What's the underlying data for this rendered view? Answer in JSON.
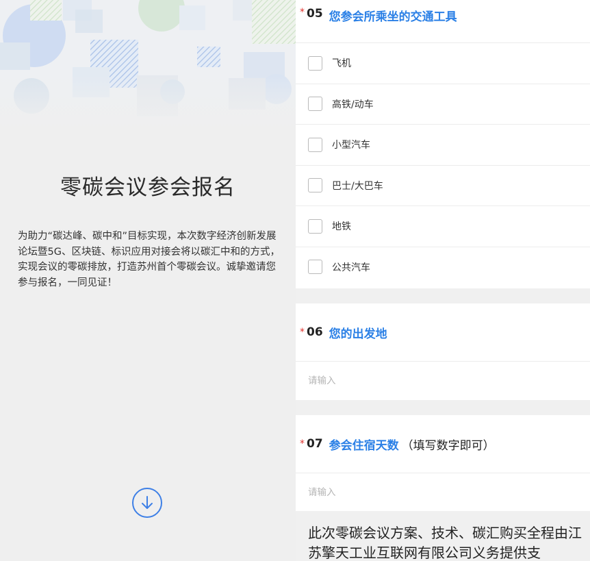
{
  "intro": {
    "title": "零碳会议参会报名",
    "description": "为助力“碳达峰、碳中和”目标实现，本次数字经济创新发展论坛暨5G、区块链、标识应用对接会将以碳汇中和的方式，实现会议的零碳排放，打造苏州首个零碳会议。诚挚邀请您参与报名，一同见证！",
    "down_icon": "arrow-down-circle-icon"
  },
  "questions": {
    "q05": {
      "required_mark": "*",
      "number": "05",
      "title": "您参会所乘坐的交通工具",
      "options": [
        {
          "label": "飞机"
        },
        {
          "label": "高铁/动车"
        },
        {
          "label": "小型汽车"
        },
        {
          "label": "巴士/大巴车"
        },
        {
          "label": "地铁"
        },
        {
          "label": "公共汽车"
        }
      ]
    },
    "q06": {
      "required_mark": "*",
      "number": "06",
      "title": "您的出发地",
      "placeholder": "请输入",
      "value": ""
    },
    "q07": {
      "required_mark": "*",
      "number": "07",
      "title": "参会住宿天数",
      "hint": "（填写数字即可）",
      "placeholder": "请输入",
      "value": ""
    }
  },
  "footer": {
    "text": "此次零碳会议方案、技术、碳汇购买全程由江苏擎天工业互联网有限公司义务提供支"
  },
  "colors": {
    "accent": "#2b80e6",
    "required": "#e0322d",
    "icon_blue": "#3d7fe6"
  }
}
